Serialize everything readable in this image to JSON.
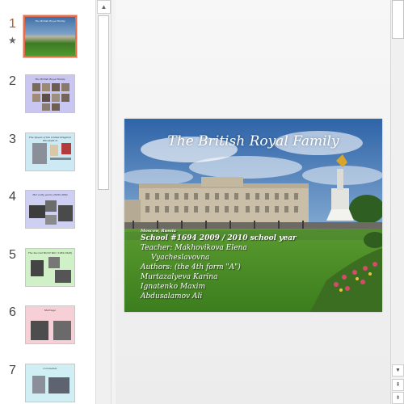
{
  "thumbnails": [
    {
      "number": "1",
      "title": "The British Royal Family",
      "active": true,
      "has_animation": true,
      "bg": "#3d5a2a"
    },
    {
      "number": "2",
      "title": "The British Royal Family",
      "active": false,
      "bg": "#c9c6f2"
    },
    {
      "number": "3",
      "title": "The Queen of the United Kingdom Elizabeth II",
      "active": false,
      "bg": "#cde9f3"
    },
    {
      "number": "4",
      "title": "Her early years (1926-1939)",
      "active": false,
      "bg": "#cfcff4"
    },
    {
      "number": "5",
      "title": "The Second World War (1939-1945)",
      "active": false,
      "bg": "#d0f0c8"
    },
    {
      "number": "6",
      "title": "Marriage",
      "active": false,
      "bg": "#f6d0d6"
    },
    {
      "number": "7",
      "title": "Coronation",
      "active": false,
      "bg": "#cfeff5"
    }
  ],
  "icons": {
    "animation": "★",
    "scroll_up": "▲",
    "scroll_down": "▼",
    "prev_slide": "⇞",
    "next_slide": "⇟"
  },
  "slide": {
    "title": "The British Royal Family",
    "body": {
      "line1": "Moscow, Russia",
      "line2": "School #1694   2009 / 2010 school  year",
      "line3": "Teacher: Makhovikova  Elena",
      "line4": "Vyacheslavovna",
      "line5": "Authors: (the 4th form \"A\")",
      "line6": "Murtazalyeva Karina",
      "line7": "Ignatenko Maxim",
      "line8": "Abdusalamov Ali"
    }
  },
  "colors": {
    "active_accent": "#c55a11",
    "sky": "#4a7fc1",
    "grass": "#4f9a2c"
  }
}
